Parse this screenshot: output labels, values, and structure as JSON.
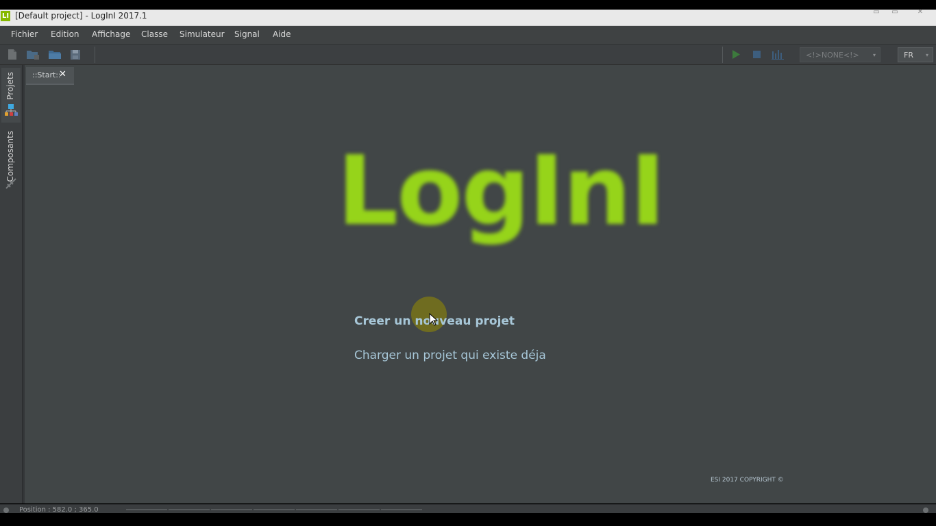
{
  "window": {
    "app_icon": "LI",
    "title": "[Default project] - LogInI 2017.1",
    "buttons": [
      "minimize-icon",
      "maximize-icon",
      "close-icon"
    ],
    "min_glyph": "▭",
    "max_glyph": "▭",
    "close_glyph": "✕"
  },
  "menu": {
    "items": [
      "Fichier",
      "Edition",
      "Affichage",
      "Classe",
      "Simulateur",
      "Signal",
      "Aide"
    ]
  },
  "toolbar": {
    "left_icons": [
      "new-file-icon",
      "new-project-icon",
      "open-folder-icon",
      "save-icon"
    ],
    "right_icons": [
      "play-icon",
      "stop-icon",
      "chronogram-icon"
    ],
    "signal_select": "<!>NONE<!>",
    "language": "FR",
    "caret": "▾"
  },
  "sidebar": {
    "tabs": [
      {
        "label": "Projets",
        "icon": "project-tree-icon"
      },
      {
        "label": "Composants",
        "icon": "components-icon"
      }
    ]
  },
  "editor": {
    "tab_label": "::Start::",
    "tab_close": "✕"
  },
  "start_page": {
    "logo_text": "LogInI",
    "create_link": "Creer un nouveau projet",
    "load_link": "Charger un projet qui existe déja",
    "copyright": "ESI 2017 COPYRIGHT ©"
  },
  "statusbar": {
    "position_text": "Position : 582.0 ; 365.0"
  },
  "colors": {
    "logo": "#96d41a",
    "link": "#a7c7d8",
    "background": "#414647",
    "accent_green": "#86b800"
  }
}
